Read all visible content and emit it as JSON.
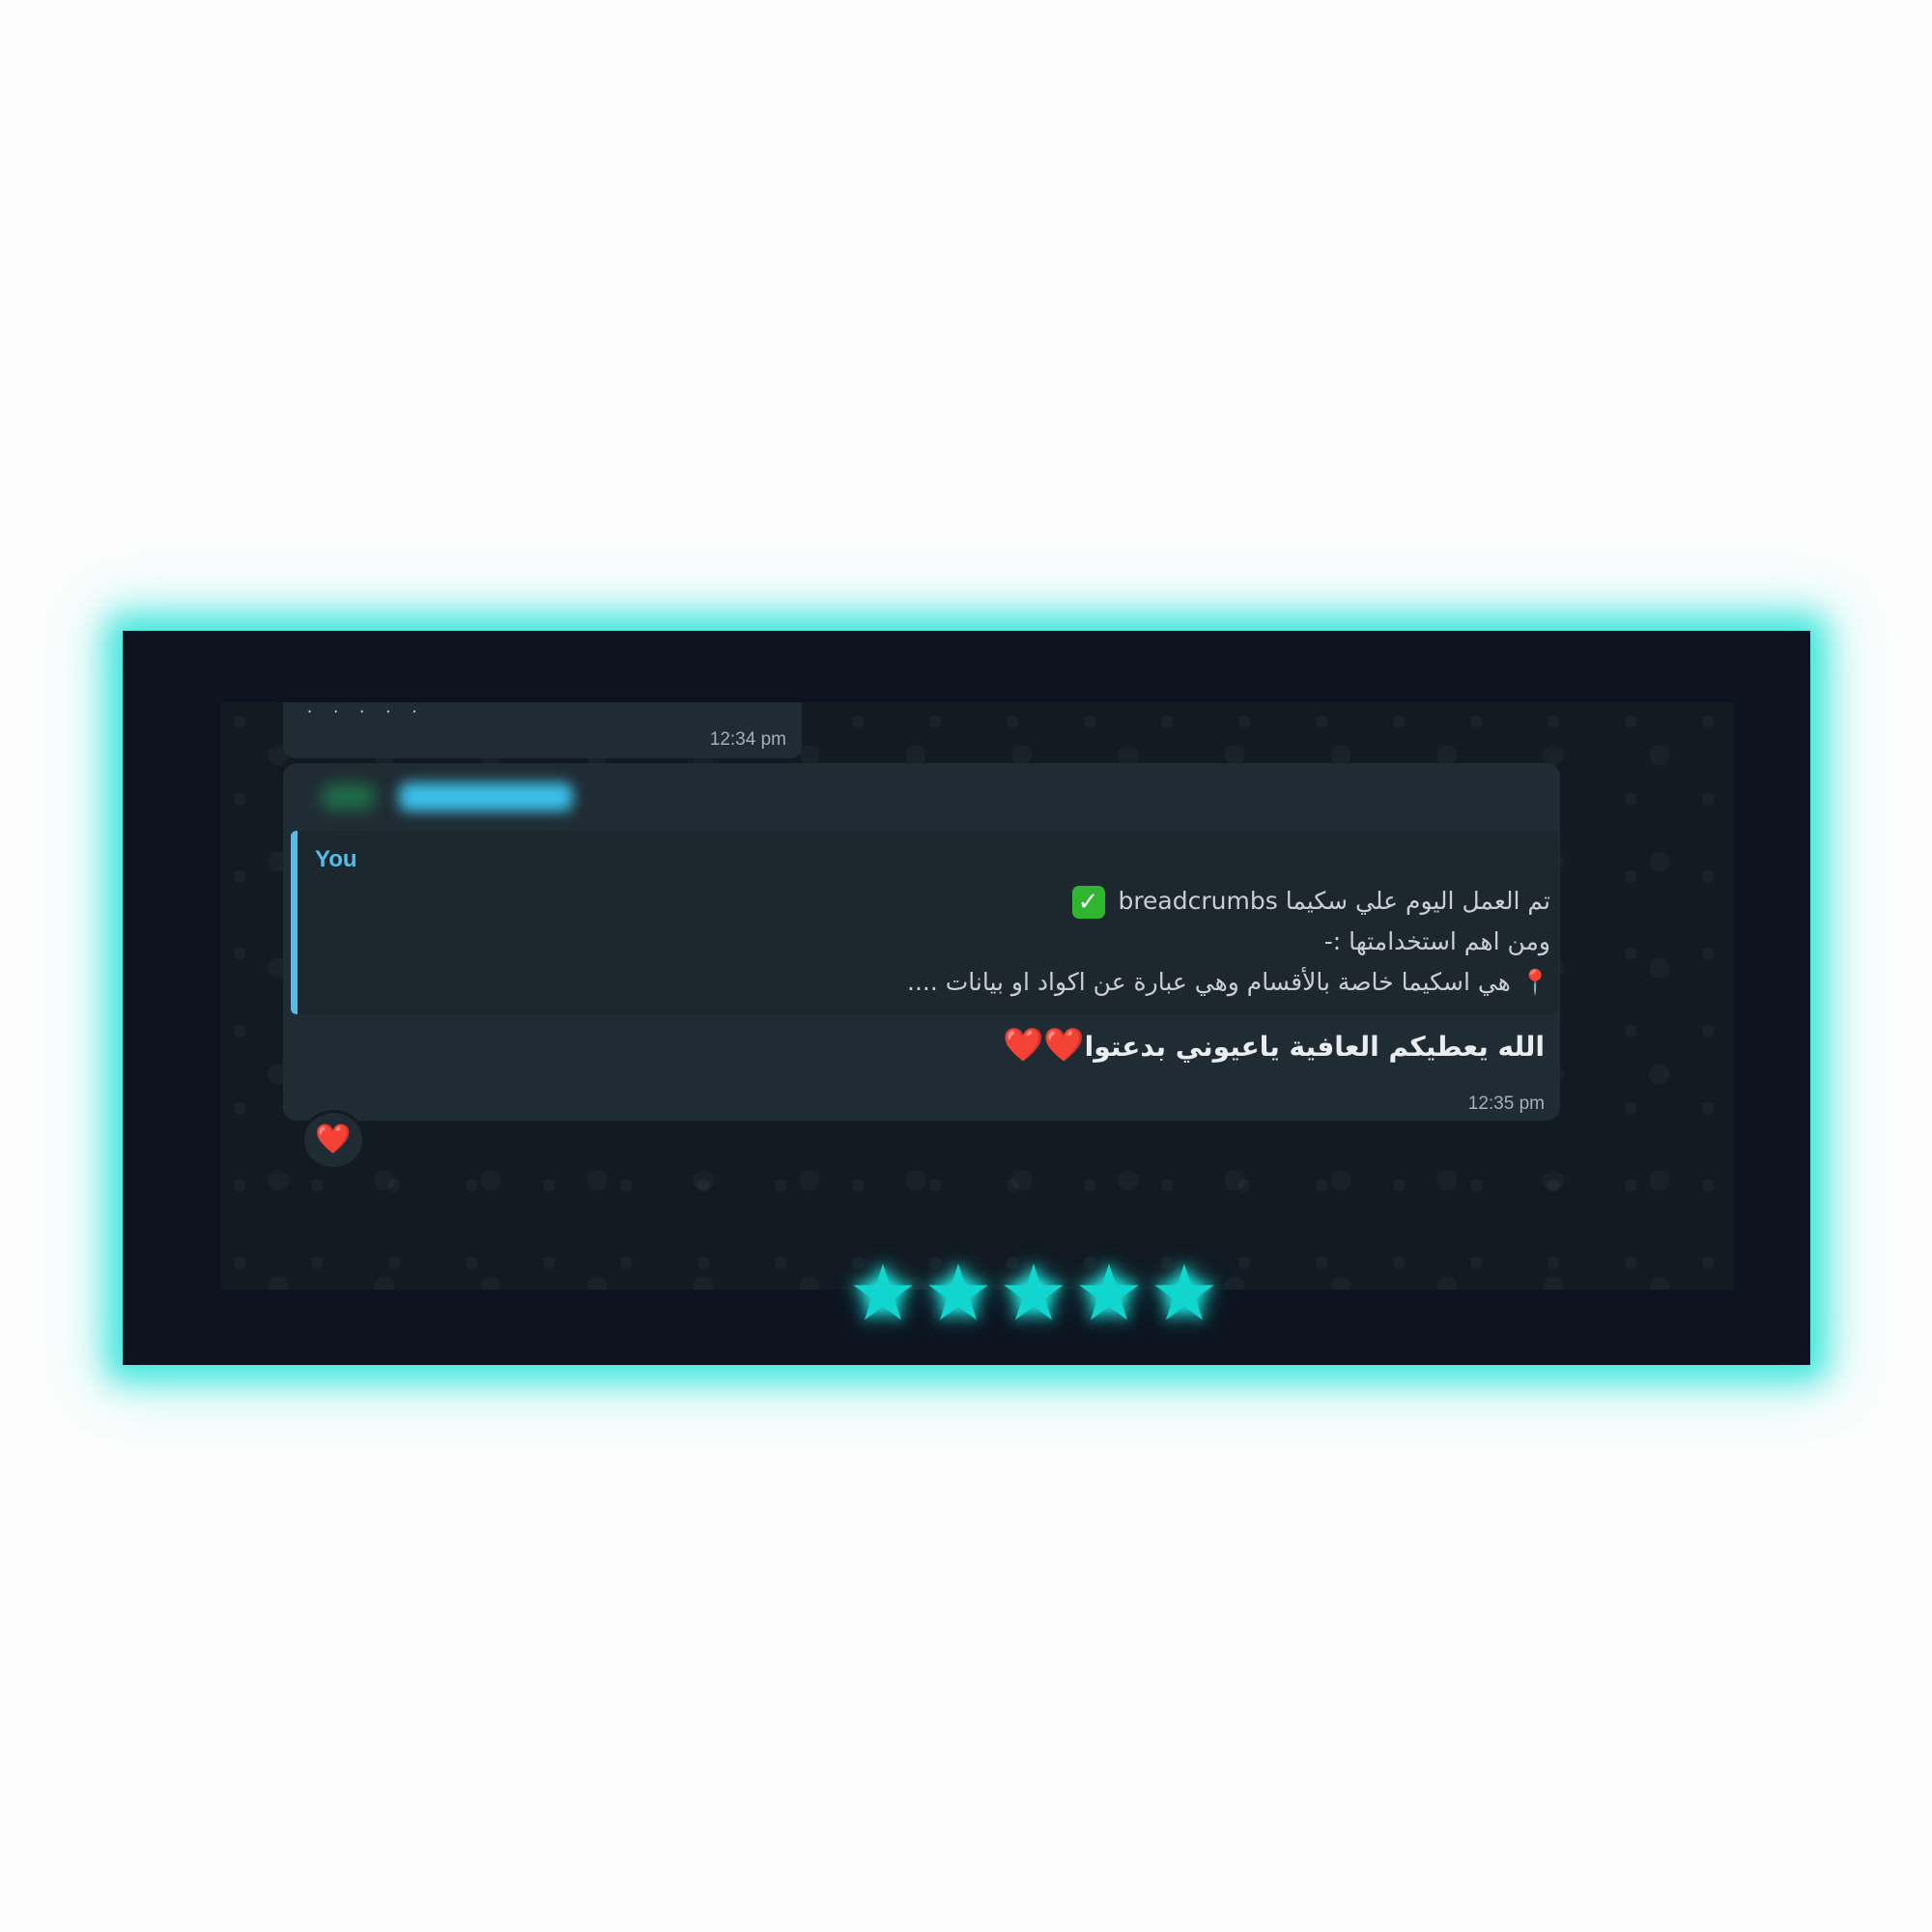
{
  "previous_message": {
    "time": "12:34 pm"
  },
  "message": {
    "quote": {
      "author": "You",
      "line1_text": "تم العمل اليوم علي سكيما",
      "line1_code": "breadcrumbs",
      "line1_icon": "check-mark-button-icon",
      "line2": "ومن اهم استخدامتها :-",
      "line3_icon": "round-pushpin-icon",
      "line3": "هي اسكيما خاصة بالأقسام وهي عبارة عن اكواد او بيانات ...."
    },
    "text": "الله يعطيكم العافية ياعيوني بدعتوا",
    "hearts": "❤️❤️",
    "time": "12:35 pm",
    "reaction": "❤️"
  },
  "rating": {
    "value": 5,
    "max": 5,
    "color": "#11d6cf"
  },
  "colors": {
    "frame_glow": "#3ee6dc",
    "author": "#53bdeb",
    "bubble": "#202c33"
  }
}
